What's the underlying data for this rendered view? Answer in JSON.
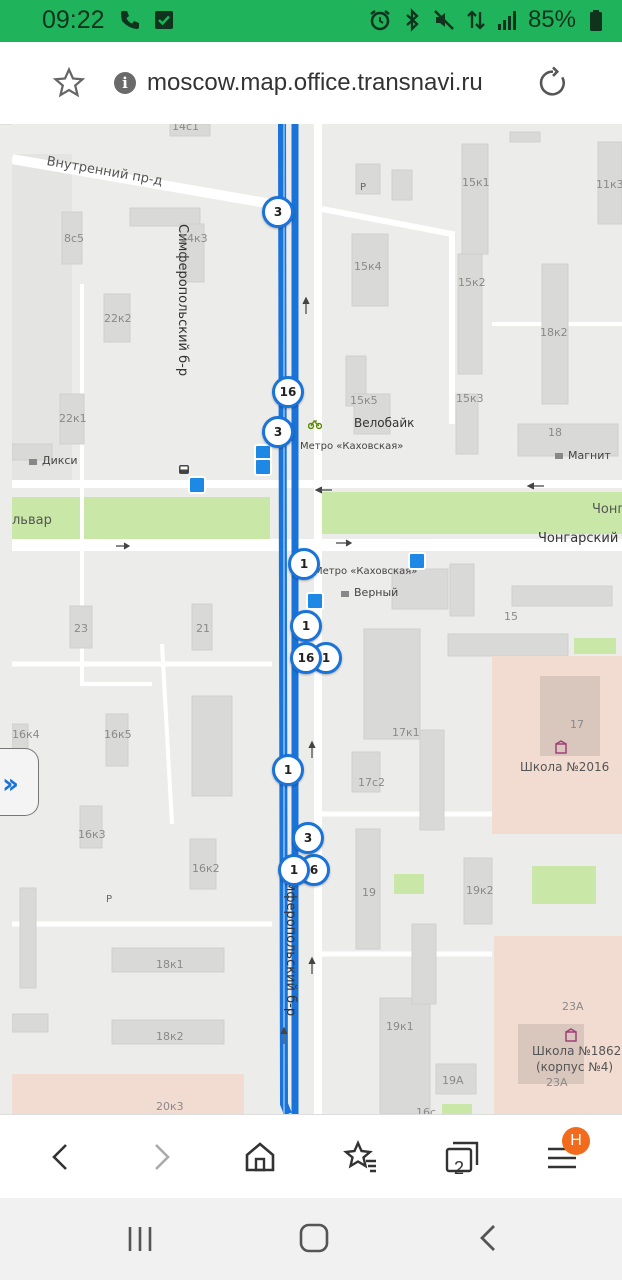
{
  "status_bar": {
    "time": "09:22",
    "battery": "85%",
    "left_icons": [
      "phone-icon",
      "check-square-icon"
    ],
    "right_icons": [
      "alarm-icon",
      "bluetooth-icon",
      "mute-icon",
      "data-transfer-icon",
      "signal-icon",
      "battery-icon"
    ]
  },
  "address_bar": {
    "url": "moscow.map.office.transnavi.ru"
  },
  "map": {
    "streets": {
      "inner": "Внутренний пр-д",
      "simf_top": "Симферопольский б-р",
      "simf_bottom": "Симферопольский б-р",
      "chongarsky": "Чонгарский",
      "chong_right": "Чонг",
      "bulvar_left": "львар"
    },
    "pois": {
      "velobike": "Велобайк",
      "metro1": "Метро «Каховская»",
      "metro2": "Метро «Каховская»",
      "dixi": "Дикси",
      "magnit": "Магнит",
      "verny": "Верный",
      "school1": "Школа №2016",
      "school2_line1": "Школа №1862",
      "school2_line2": "(корпус №4)"
    },
    "buildings": [
      "14с1",
      "8с5",
      "14к3",
      "22к2",
      "22к1",
      "15к1",
      "11к3",
      "15к4",
      "15к2",
      "18к2",
      "15к5",
      "15к3",
      "18",
      "23",
      "21",
      "15",
      "16к4",
      "16к5",
      "17к1",
      "17",
      "17с2",
      "16к3",
      "16к2",
      "19",
      "19к2",
      "18к1",
      "18к2",
      "19к1",
      "23А",
      "19А",
      "23А",
      "20к3",
      "16с"
    ],
    "route_markers": [
      "3",
      "16",
      "3",
      "1",
      "1",
      "16",
      "1",
      "1",
      "3",
      "1",
      "6"
    ]
  },
  "toolbar": {
    "tab_count": "2",
    "badge": "Н"
  }
}
